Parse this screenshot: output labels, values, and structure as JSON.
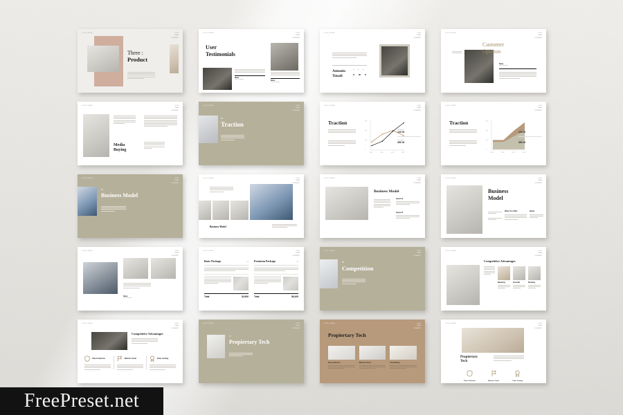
{
  "watermark": {
    "text": "FreePreset.net"
  },
  "palette": {
    "page_bg": "#e9e8e4",
    "slide_bg": "#ffffff",
    "olive": "#b5b09a",
    "tan": "#b79a7c",
    "blush": "#cfae9e",
    "gold_text": "#a08a63",
    "ink": "#1d1d1b",
    "muted": "#9a988f"
  },
  "deck": {
    "slide_count": 20,
    "columns": 4,
    "rows": 5,
    "header_label": "LOGO HERE",
    "page_meta": [
      "01.05",
      "YEAR",
      "COMPANY"
    ]
  },
  "slides": [
    {
      "id": 1,
      "name": "three-product",
      "title_line1": "Three :",
      "title_line2": "Product",
      "kicker": "",
      "theme": "light"
    },
    {
      "id": 2,
      "name": "user-testimonials",
      "title_line1": "User",
      "title_line2": "Testimonials",
      "kicker": "",
      "theme": "light",
      "quotes": [
        {
          "name": "Name",
          "role": "Your Position"
        },
        {
          "name": "Name",
          "role": "Your Position"
        }
      ]
    },
    {
      "id": 3,
      "name": "antonio-tonali",
      "title_line1": "Antonio",
      "title_line2": "Tonali",
      "kicker": "",
      "theme": "light",
      "socials": [
        "fb",
        "tw",
        "ig"
      ]
    },
    {
      "id": 4,
      "name": "customer-opinion",
      "title_line1": "Customer",
      "title_line2": "Opinion",
      "kicker": "",
      "theme": "light",
      "caption": {
        "name": "Name",
        "role": "Your Position"
      }
    },
    {
      "id": 5,
      "name": "media-buying",
      "title_line1": "Media",
      "title_line2": "Buying",
      "kicker": "",
      "theme": "light"
    },
    {
      "id": 6,
      "name": "traction-cover",
      "title_line1": "Traction",
      "title_line2": "",
      "kicker": "04",
      "theme": "olive"
    },
    {
      "id": 7,
      "name": "traction-line-chart",
      "title_line1": "Traction",
      "title_line2": "",
      "kicker": "",
      "theme": "light",
      "stats": [
        {
          "label": "Customer",
          "value": "120 M"
        },
        {
          "label": "Customer",
          "value": "350 M"
        }
      ]
    },
    {
      "id": 8,
      "name": "traction-area-chart",
      "title_line1": "Traction",
      "title_line2": "",
      "kicker": "",
      "theme": "light",
      "stats": [
        {
          "label": "Customer",
          "value": "120 M"
        },
        {
          "label": "Customer",
          "value": "350 M"
        }
      ]
    },
    {
      "id": 9,
      "name": "business-model-cover",
      "title_line1": "Business Model",
      "title_line2": "",
      "kicker": "05",
      "theme": "olive"
    },
    {
      "id": 10,
      "name": "business-model-gallery",
      "title_line1": "Business Model",
      "title_line2": "",
      "kicker": "",
      "theme": "light"
    },
    {
      "id": 11,
      "name": "business-model-detail",
      "title_line1": "Business Model",
      "title_line2": "",
      "kicker": "",
      "theme": "light",
      "subheads": [
        "Keyword",
        "Keyword"
      ]
    },
    {
      "id": 12,
      "name": "business-model-split",
      "title_line1": "Business",
      "title_line2": "Model",
      "kicker": "",
      "theme": "light",
      "columns": [
        {
          "head": "What You Offer"
        },
        {
          "head": "Retail"
        }
      ]
    },
    {
      "id": 13,
      "name": "product-showcase",
      "title_line1": "",
      "title_line2": "",
      "kicker": "",
      "theme": "light",
      "caption": {
        "name": "Name",
        "role": "Your Position"
      }
    },
    {
      "id": 14,
      "name": "pricing-packages",
      "title_line1": "",
      "title_line2": "",
      "kicker": "",
      "theme": "light",
      "packages": [
        {
          "name": "Basic Package",
          "badge": "01",
          "total_label": "Total",
          "total_value": "$4,900"
        },
        {
          "name": "Premium Package",
          "badge": "02",
          "total_label": "Total",
          "total_value": "$6,400"
        }
      ]
    },
    {
      "id": 15,
      "name": "competition-cover",
      "title_line1": "Competition",
      "title_line2": "",
      "kicker": "06",
      "theme": "olive"
    },
    {
      "id": 16,
      "name": "competitive-advantages-a",
      "title_line1": "Competitive Advantages",
      "title_line2": "",
      "kicker": "",
      "theme": "light",
      "cards": [
        {
          "label": "Marketing"
        },
        {
          "label": "Essential"
        },
        {
          "label": "Branding"
        }
      ]
    },
    {
      "id": 17,
      "name": "competitive-advantages-b",
      "title_line1": "Competitive Advantages",
      "title_line2": "",
      "kicker": "",
      "theme": "light",
      "features": [
        {
          "icon": "shield-icon",
          "label": "Client Collection"
        },
        {
          "icon": "flag-icon",
          "label": "Machine Cloud"
        },
        {
          "icon": "badge-icon",
          "label": "Order Landing"
        }
      ]
    },
    {
      "id": 18,
      "name": "propiertary-tech-cover",
      "title_line1": "Propiertary Tech",
      "title_line2": "",
      "kicker": "07",
      "theme": "olive"
    },
    {
      "id": 19,
      "name": "propiertary-tech-cards",
      "title_line1": "Propiertary Tech",
      "title_line2": "",
      "kicker": "",
      "theme": "tan",
      "cards": [
        {
          "label": "Step Collection"
        },
        {
          "label": "Machine Cloud"
        },
        {
          "label": "Outstanding"
        }
      ]
    },
    {
      "id": 20,
      "name": "propiertary-tech-icons",
      "title_line1": "Propiertary",
      "title_line2": "Tech",
      "kicker": "",
      "theme": "light",
      "features": [
        {
          "icon": "shield-icon",
          "label": "Client Collection"
        },
        {
          "icon": "flag-icon",
          "label": "Machine Cloud"
        },
        {
          "icon": "badge-icon",
          "label": "Order Landing"
        }
      ]
    }
  ],
  "chart_data": [
    {
      "chart_id": 7,
      "type": "line",
      "title": "Traction",
      "x": [
        "2019",
        "2020",
        "2021",
        "2022"
      ],
      "series": [
        {
          "name": "Customer A",
          "values": [
            120,
            240,
            300,
            220
          ],
          "color": "#b08a5e"
        },
        {
          "name": "Customer B",
          "values": [
            60,
            130,
            290,
            420
          ],
          "color": "#1d1d1b"
        }
      ],
      "ylabel": "",
      "xlabel": "",
      "ylim": [
        0,
        450
      ],
      "grid": false,
      "legend": "right",
      "annotations": [
        {
          "label": "Customer",
          "value": "120 M"
        },
        {
          "label": "Customer",
          "value": "350 M"
        }
      ]
    },
    {
      "chart_id": 8,
      "type": "area",
      "title": "Traction",
      "x": [
        "2019",
        "2020",
        "2021",
        "2022"
      ],
      "series": [
        {
          "name": "Customer A",
          "values": [
            150,
            150,
            300,
            430
          ],
          "color": "#b79a7c"
        },
        {
          "name": "Customer B",
          "values": [
            120,
            120,
            210,
            300
          ],
          "color": "#c3c0ad"
        }
      ],
      "ylabel": "",
      "xlabel": "",
      "ylim": [
        0,
        450
      ],
      "grid": false,
      "legend": "right",
      "annotations": [
        {
          "label": "Customer",
          "value": "120 M"
        },
        {
          "label": "Customer",
          "value": "350 M"
        }
      ]
    }
  ]
}
